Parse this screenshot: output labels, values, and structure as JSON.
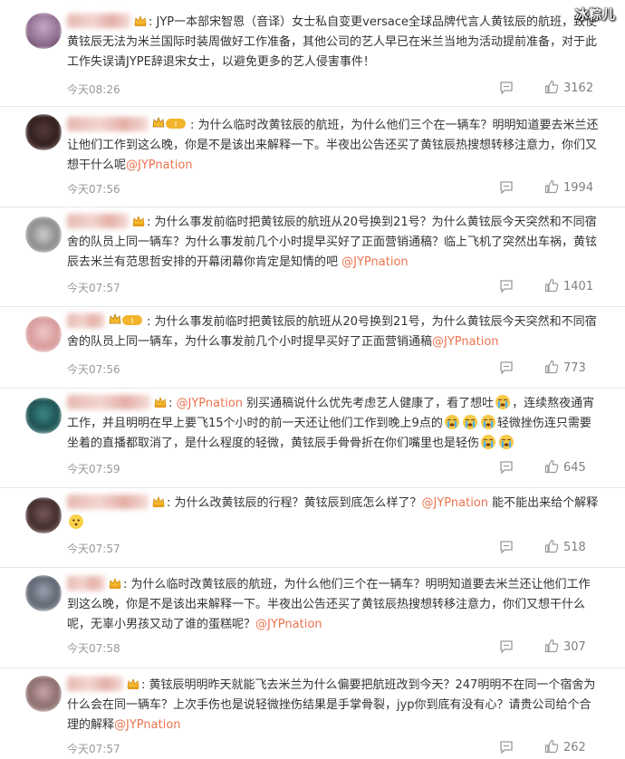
{
  "watermark": "冰粽儿",
  "icons": {
    "reply": "comment-bubble-icon",
    "like": "thumbs-up-icon",
    "crown": "crown-icon",
    "level": "fan-level-badge",
    "emoji_cry": "crying-face-emoji",
    "emoji_smile": "smiling-face-emoji"
  },
  "comments": [
    {
      "text": ": JYP一本部宋智恩（音译）女士私自变更versace全球品牌代言人黄铉辰的航班，致使黄铉辰无法为米兰国际时装周做好工作准备，其他公司的艺人早已在米兰当地为活动提前准备，对于此工作失误请JYPE辞退宋女士，以避免更多的艺人侵害事件！",
      "time": "今天08:26",
      "likes": "3162"
    },
    {
      "text": ": 为什么临时改黄铉辰的航班，为什么他们三个在一辆车？明明知道要去米兰还让他们工作到这么晚，你是不是该出来解释一下。半夜出公告还买了黄铉辰热搜想转移注意力，你们又想干什么呢",
      "mention": "@JYPnation",
      "time": "今天07:56",
      "likes": "1994"
    },
    {
      "text": ": 为什么事发前临时把黄铉辰的航班从20号换到21号？为什么黄铉辰今天突然和不同宿舍的队员上同一辆车？为什么事发前几个小时提早买好了正面营销通稿？临上飞机了突然出车祸，黄铉辰去米兰有范思哲安排的开幕闭幕你肯定是知情的吧 ",
      "mention": "@JYPnation",
      "time": "今天07:57",
      "likes": "1401"
    },
    {
      "text": ": 为什么事发前临时把黄铉辰的航班从20号换到21号，为什么黄铉辰今天突然和不同宿舍的队员上同一辆车，为什么事发前几个小时提早买好了正面营销通稿",
      "mention": "@JYPnation",
      "time": "今天07:56",
      "likes": "773"
    },
    {
      "mention": "@JYPnation",
      "text_a": " 别买通稿说什么优先考虑艺人健康了，看了想吐",
      "text_b": "，连续熬夜通宵工作，并且明明在早上要飞15个小时的前一天还让他们工作到晚上9点的",
      "text_c": "轻微挫伤连只需要坐着的直播都取消了，是什么程度的轻微，黄铉辰手骨骨折在你们嘴里也是轻伤",
      "time": "今天07:59",
      "likes": "645"
    },
    {
      "text": ": 为什么改黄铉辰的行程？黄铉辰到底怎么样了？",
      "mention": "@JYPnation",
      "text_after": " 能不能出来给个解释",
      "time": "今天07:57",
      "likes": "518"
    },
    {
      "text": ": 为什么临时改黄铉辰的航班，为什么他们三个在一辆车？明明知道要去米兰还让他们工作到这么晚，你是不是该出来解释一下。半夜出公告还买了黄铉辰热搜想转移注意力，你们又想干什么呢，无辜小男孩又动了谁的蛋糕呢？",
      "mention": "@JYPnation",
      "time": "今天07:58",
      "likes": "307"
    },
    {
      "text": ": 黄铉辰明明昨天就能飞去米兰为什么偏要把航班改到今天？247明明不在同一个宿舍为什么会在同一辆车？上次手伤也是说轻微挫伤结果是手掌骨裂，jyp你到底有没有心？请贵公司给个合理的解释",
      "mention": "@JYPnation",
      "time": "今天07:57",
      "likes": "262"
    }
  ]
}
